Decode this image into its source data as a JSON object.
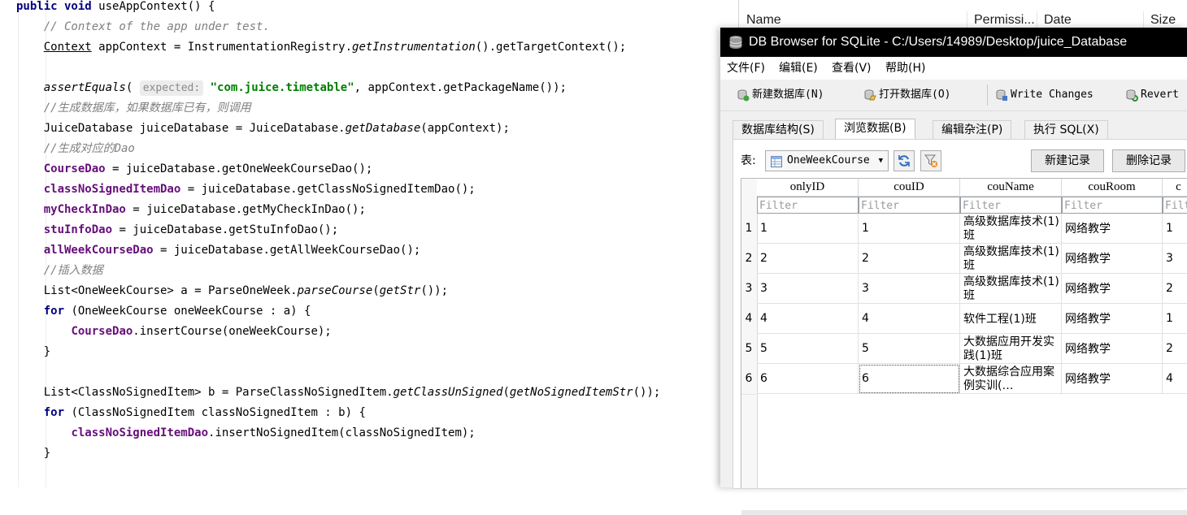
{
  "editor": {
    "lines": [
      [
        {
          "t": "public void ",
          "c": "kw"
        },
        {
          "t": "useAppContext() {"
        }
      ],
      [
        {
          "t": "    "
        },
        {
          "t": "// Context of the app under test.",
          "c": "cm"
        }
      ],
      [
        {
          "t": "    "
        },
        {
          "t": "Context",
          "c": "lnk"
        },
        {
          "t": " appContext = InstrumentationRegistry."
        },
        {
          "t": "getInstrumentation",
          "c": "it"
        },
        {
          "t": "().getTargetContext();"
        }
      ],
      [],
      [
        {
          "t": "    "
        },
        {
          "t": "assertEquals",
          "c": "it"
        },
        {
          "t": "( "
        },
        {
          "t": "expected:",
          "c": "hint"
        },
        {
          "t": " "
        },
        {
          "t": "\"com.juice.timetable\"",
          "c": "str"
        },
        {
          "t": ", appContext.getPackageName());"
        }
      ],
      [
        {
          "t": "    "
        },
        {
          "t": "//生成数据库，如果数据库已有，则调用",
          "c": "cm"
        }
      ],
      [
        {
          "t": "    JuiceDatabase juiceDatabase = JuiceDatabase."
        },
        {
          "t": "getDatabase",
          "c": "it"
        },
        {
          "t": "(appContext);"
        }
      ],
      [
        {
          "t": "    "
        },
        {
          "t": "//生成对应的Dao",
          "c": "cm"
        }
      ],
      [
        {
          "t": "    "
        },
        {
          "t": "CourseDao",
          "c": "fld"
        },
        {
          "t": " = juiceDatabase.getOneWeekCourseDao();"
        }
      ],
      [
        {
          "t": "    "
        },
        {
          "t": "classNoSignedItemDao",
          "c": "fld"
        },
        {
          "t": " = juiceDatabase.getClassNoSignedItemDao();"
        }
      ],
      [
        {
          "t": "    "
        },
        {
          "t": "myCheckInDao",
          "c": "fld"
        },
        {
          "t": " = juiceDatabase.getMyCheckInDao();"
        }
      ],
      [
        {
          "t": "    "
        },
        {
          "t": "stuInfoDao",
          "c": "fld"
        },
        {
          "t": " = juiceDatabase.getStuInfoDao();"
        }
      ],
      [
        {
          "t": "    "
        },
        {
          "t": "allWeekCourseDao",
          "c": "fld"
        },
        {
          "t": " = juiceDatabase.getAllWeekCourseDao();"
        }
      ],
      [
        {
          "t": "    "
        },
        {
          "t": "//插入数据",
          "c": "cm"
        }
      ],
      [
        {
          "t": "    List<OneWeekCourse> a = ParseOneWeek."
        },
        {
          "t": "parseCourse",
          "c": "it"
        },
        {
          "t": "("
        },
        {
          "t": "getStr",
          "c": "it"
        },
        {
          "t": "());"
        }
      ],
      [
        {
          "t": "    "
        },
        {
          "t": "for",
          "c": "kw"
        },
        {
          "t": " (OneWeekCourse oneWeekCourse : a) {"
        }
      ],
      [
        {
          "t": "        "
        },
        {
          "t": "CourseDao",
          "c": "fld"
        },
        {
          "t": ".insertCourse(oneWeekCourse);"
        }
      ],
      [
        {
          "t": "    }"
        }
      ],
      [],
      [
        {
          "t": "    List<ClassNoSignedItem> b = ParseClassNoSignedItem."
        },
        {
          "t": "getClassUnSigned",
          "c": "it"
        },
        {
          "t": "("
        },
        {
          "t": "getNoSignedItemStr",
          "c": "it"
        },
        {
          "t": "());"
        }
      ],
      [
        {
          "t": "    "
        },
        {
          "t": "for",
          "c": "kw"
        },
        {
          "t": " (ClassNoSignedItem classNoSignedItem : b) {"
        }
      ],
      [
        {
          "t": "        "
        },
        {
          "t": "classNoSignedItemDao",
          "c": "fld"
        },
        {
          "t": ".insertNoSignedItem(classNoSignedItem);"
        }
      ],
      [
        {
          "t": "    }"
        }
      ]
    ]
  },
  "explorer": {
    "columns": [
      "Name",
      "Permissi...",
      "Date",
      "Size"
    ]
  },
  "db": {
    "title": "DB Browser for SQLite - C:/Users/14989/Desktop/juice_Database",
    "menu": [
      "文件(F)",
      "编辑(E)",
      "查看(V)",
      "帮助(H)"
    ],
    "toolbar": {
      "new_db": "新建数据库(N)",
      "open_db": "打开数据库(O)",
      "write": "Write Changes",
      "revert": "Revert"
    },
    "tabs": [
      "数据库结构(S)",
      "浏览数据(B)",
      "编辑杂注(P)",
      "执行 SQL(X)"
    ],
    "active_tab": 1,
    "table_label": "表:",
    "table_name": "OneWeekCourse",
    "new_record": "新建记录",
    "delete_record": "删除记录",
    "filter_placeholder": "Filter",
    "columns": [
      "onlyID",
      "couID",
      "couName",
      "couRoom",
      "c"
    ],
    "rows": [
      {
        "num": "1",
        "cells": [
          "1",
          "1",
          "高级数据库技术(1)班",
          "网络教学",
          "1"
        ]
      },
      {
        "num": "2",
        "cells": [
          "2",
          "2",
          "高级数据库技术(1)班",
          "网络教学",
          "3"
        ]
      },
      {
        "num": "3",
        "cells": [
          "3",
          "3",
          "高级数据库技术(1)班",
          "网络教学",
          "2"
        ]
      },
      {
        "num": "4",
        "cells": [
          "4",
          "4",
          "软件工程(1)班",
          "网络教学",
          "1"
        ]
      },
      {
        "num": "5",
        "cells": [
          "5",
          "5",
          "大数据应用开发实践(1)班",
          "网络教学",
          "2"
        ]
      },
      {
        "num": "6",
        "cells": [
          "6",
          "6",
          "大数据综合应用案例实训(…",
          "网络教学",
          "4"
        ]
      }
    ]
  },
  "colors": {
    "keyword": "#000080",
    "comment": "#808080",
    "field": "#660e7a",
    "string": "#008000",
    "titlebar": "#000000"
  }
}
